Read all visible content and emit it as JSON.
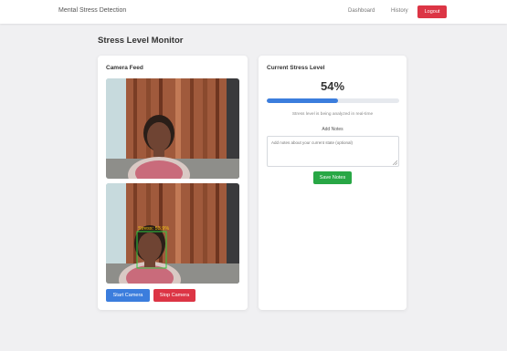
{
  "navbar": {
    "brand": "Mental Stress Detection",
    "links": [
      "Dashboard",
      "History"
    ],
    "logout_label": "Logout"
  },
  "page_title": "Stress Level Monitor",
  "camera_card": {
    "title": "Camera Feed",
    "detection_label": "Stress: 53.9%",
    "start_label": "Start Camera",
    "stop_label": "Stop Camera"
  },
  "stress_card": {
    "title": "Current Stress Level",
    "value_text": "54%",
    "progress": 0.54,
    "analysis_text": "Stress level is being analyzed in real-time",
    "notes_label": "Add Notes",
    "notes_placeholder": "Add notes about your current state (optional)",
    "save_label": "Save Notes"
  },
  "colors": {
    "primary": "#3b7ddd",
    "danger": "#dc3545",
    "success": "#28a745",
    "detection_box": "#2ecc40",
    "detection_text": "#f1c40f"
  },
  "icons": {
    "resize_handle": "resize-grip-icon"
  }
}
